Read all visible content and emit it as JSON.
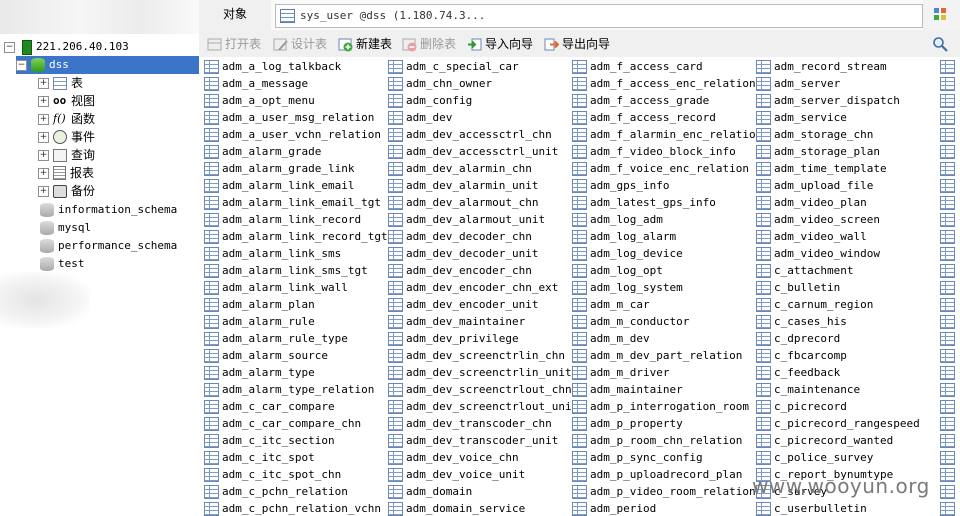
{
  "object_tab": "对象",
  "doc_tab": "sys_user @dss (1.180.74.3...",
  "toolbar": {
    "open_table": "打开表",
    "design_table": "设计表",
    "new_table": "新建表",
    "delete_table": "删除表",
    "import_wizard": "导入向导",
    "export_wizard": "导出向导"
  },
  "tree": {
    "connection": "221.206.40.103",
    "selected_db": "dss",
    "children": [
      "表",
      "视图",
      "函数",
      "事件",
      "查询",
      "报表",
      "备份"
    ],
    "other_dbs": [
      "information_schema",
      "mysql",
      "performance_schema",
      "test"
    ]
  },
  "tables": {
    "col1": [
      "adm_a_log_talkback",
      "adm_a_message",
      "adm_a_opt_menu",
      "adm_a_user_msg_relation",
      "adm_a_user_vchn_relation",
      "adm_alarm_grade",
      "adm_alarm_grade_link",
      "adm_alarm_link_email",
      "adm_alarm_link_email_tgt",
      "adm_alarm_link_record",
      "adm_alarm_link_record_tgt",
      "adm_alarm_link_sms",
      "adm_alarm_link_sms_tgt",
      "adm_alarm_link_wall",
      "adm_alarm_plan",
      "adm_alarm_rule",
      "adm_alarm_rule_type",
      "adm_alarm_source",
      "adm_alarm_type",
      "adm_alarm_type_relation",
      "adm_c_car_compare",
      "adm_c_car_compare_chn",
      "adm_c_itc_section",
      "adm_c_itc_spot",
      "adm_c_itc_spot_chn",
      "adm_c_pchn_relation",
      "adm_c_pchn_relation_vchn"
    ],
    "col2": [
      "adm_c_special_car",
      "adm_chn_owner",
      "adm_config",
      "adm_dev",
      "adm_dev_accessctrl_chn",
      "adm_dev_accessctrl_unit",
      "adm_dev_alarmin_chn",
      "adm_dev_alarmin_unit",
      "adm_dev_alarmout_chn",
      "adm_dev_alarmout_unit",
      "adm_dev_decoder_chn",
      "adm_dev_decoder_unit",
      "adm_dev_encoder_chn",
      "adm_dev_encoder_chn_ext",
      "adm_dev_encoder_unit",
      "adm_dev_maintainer",
      "adm_dev_privilege",
      "adm_dev_screenctrlin_chn",
      "adm_dev_screenctrlin_unit",
      "adm_dev_screenctrlout_chn",
      "adm_dev_screenctrlout_unit",
      "adm_dev_transcoder_chn",
      "adm_dev_transcoder_unit",
      "adm_dev_voice_chn",
      "adm_dev_voice_unit",
      "adm_domain",
      "adm_domain_service"
    ],
    "col3": [
      "adm_f_access_card",
      "adm_f_access_enc_relation",
      "adm_f_access_grade",
      "adm_f_access_record",
      "adm_f_alarmin_enc_relation",
      "adm_f_video_block_info",
      "adm_f_voice_enc_relation",
      "adm_gps_info",
      "adm_latest_gps_info",
      "adm_log_adm",
      "adm_log_alarm",
      "adm_log_device",
      "adm_log_opt",
      "adm_log_system",
      "adm_m_car",
      "adm_m_conductor",
      "adm_m_dev",
      "adm_m_dev_part_relation",
      "adm_m_driver",
      "adm_maintainer",
      "adm_p_interrogation_room",
      "adm_p_property",
      "adm_p_room_chn_relation",
      "adm_p_sync_config",
      "adm_p_uploadrecord_plan",
      "adm_p_video_room_relation",
      "adm_period"
    ],
    "col4": [
      "adm_record_stream",
      "adm_server",
      "adm_server_dispatch",
      "adm_service",
      "adm_storage_chn",
      "adm_storage_plan",
      "adm_time_template",
      "adm_upload_file",
      "adm_video_plan",
      "adm_video_screen",
      "adm_video_wall",
      "adm_video_window",
      "c_attachment",
      "c_bulletin",
      "c_carnum_region",
      "c_cases_his",
      "c_dprecord",
      "c_fbcarcomp",
      "c_feedback",
      "c_maintenance",
      "c_picrecord",
      "c_picrecord_rangespeed",
      "c_picrecord_wanted",
      "c_police_survey",
      "c_report_bynumtype",
      "c_survey",
      "c_userbulletin"
    ]
  },
  "watermark": "www.wooyun.org",
  "colors": {
    "selection": "#3b74c9",
    "toolbar_bg": "#f0f0f0"
  }
}
